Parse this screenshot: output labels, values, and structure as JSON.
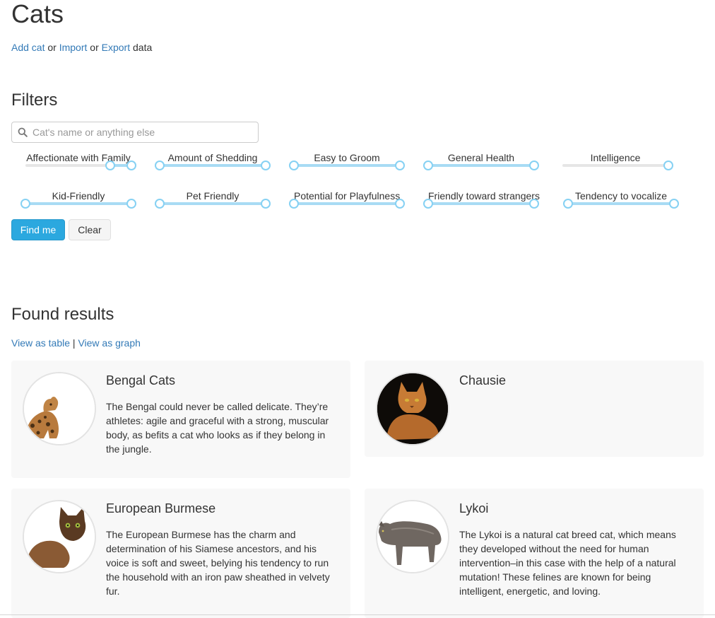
{
  "page": {
    "title": "Cats"
  },
  "actions": {
    "add": "Add cat",
    "or1": "or",
    "import": "Import",
    "or2": "or",
    "export": "Export",
    "suffix": "data"
  },
  "filters": {
    "title": "Filters",
    "search_placeholder": "Cat's name or anything else",
    "items": [
      {
        "label": "Affectionate with Family",
        "min": 0.8,
        "max": 1.0
      },
      {
        "label": "Amount of Shedding",
        "min": 0.0,
        "max": 1.0
      },
      {
        "label": "Easy to Groom",
        "min": 0.0,
        "max": 1.0
      },
      {
        "label": "General Health",
        "min": 0.0,
        "max": 1.0
      },
      {
        "label": "Intelligence",
        "min": 1.0,
        "max": 1.0
      },
      {
        "label": "Kid-Friendly",
        "min": 0.0,
        "max": 1.0
      },
      {
        "label": "Pet Friendly",
        "min": 0.0,
        "max": 1.0
      },
      {
        "label": "Potential for Playfulness",
        "min": 0.0,
        "max": 1.0
      },
      {
        "label": "Friendly toward strangers",
        "min": 0.0,
        "max": 1.0
      },
      {
        "label": "Tendency to vocalize",
        "min": 0.0,
        "max": 1.0
      }
    ],
    "find_label": "Find me",
    "clear_label": "Clear"
  },
  "results": {
    "title": "Found results",
    "view_table": "View as table",
    "separator": "|",
    "view_graph": "View as graph",
    "cards": [
      {
        "name": "Bengal Cats",
        "description": "The Bengal could never be called delicate. They’re athletes: agile and graceful with a strong, muscular body, as befits a cat who looks as if they belong in the jungle."
      },
      {
        "name": "Chausie",
        "description": ""
      },
      {
        "name": "European Burmese",
        "description": "The European Burmese has the charm and determination of his Siamese ancestors, and his voice is soft and sweet, belying his tendency to run the household with an iron paw sheathed in velvety fur."
      },
      {
        "name": "Lykoi",
        "description": "The Lykoi is a natural cat breed cat, which means they developed without the need for human intervention–in this case with the help of a natural mutation! These felines are known for being intelligent, energetic, and loving."
      }
    ]
  },
  "colors": {
    "link": "#337ab7",
    "primary": "#2ba8df",
    "slider_range": "#a8dbf4",
    "slider_handle": "#86d1f3",
    "card_bg": "#f8f8f8"
  },
  "icons": {
    "search": "search-icon"
  }
}
